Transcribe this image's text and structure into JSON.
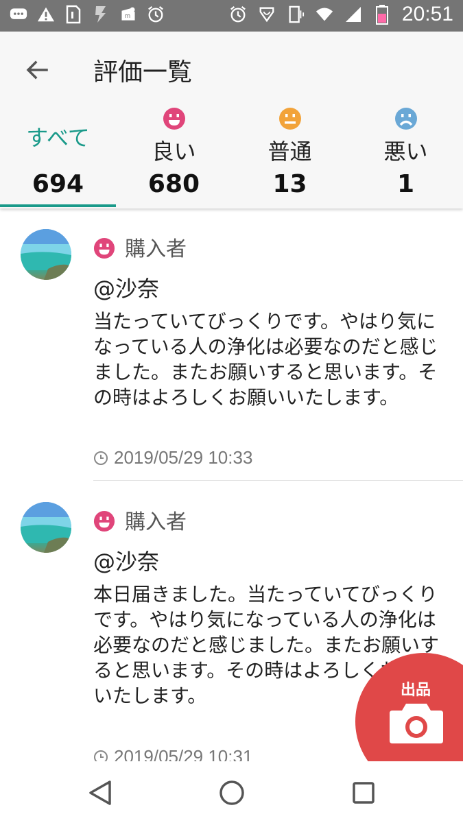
{
  "status_bar": {
    "time": "20:51",
    "left_icons": [
      "message-icon",
      "warning-icon",
      "sim-icon",
      "download-icon",
      "mercari-icon",
      "alarm-icon"
    ],
    "right_icons": [
      "alarm-icon",
      "heart-icon",
      "vibrate-icon",
      "wifi-icon",
      "signal-icon",
      "battery-icon"
    ]
  },
  "header": {
    "title": "評価一覧",
    "back_icon": "arrow-back-icon"
  },
  "tabs": [
    {
      "label": "すべて",
      "count": "694",
      "active": true
    },
    {
      "label": "良い",
      "count": "680",
      "face": "good-face-icon",
      "color": "#e0457a"
    },
    {
      "label": "普通",
      "count": "13",
      "face": "neutral-face-icon",
      "color": "#f2a33a"
    },
    {
      "label": "悪い",
      "count": "1",
      "face": "bad-face-icon",
      "color": "#6aa8d6"
    }
  ],
  "reviews": [
    {
      "role": "購入者",
      "user": "@沙奈",
      "body": "当たっていてびっくりです。やはり気になっている人の浄化は必要なのだと感じました。またお願いすると思います。その時はよろしくお願いいたします。",
      "timestamp": "2019/05/29 10:33"
    },
    {
      "role": "購入者",
      "user": "@沙奈",
      "body": "本日届きました。当たっていてびっくりです。やはり気になっている人の浄化は必要なのだと感じました。またお願いすると思います。その時はよろしくお願いいたします。",
      "timestamp": "2019/05/29 10:31"
    }
  ],
  "fab": {
    "label": "出品",
    "icon": "camera-icon"
  },
  "colors": {
    "accent": "#1a9a8a",
    "fab": "#e04848",
    "good": "#e0457a"
  }
}
